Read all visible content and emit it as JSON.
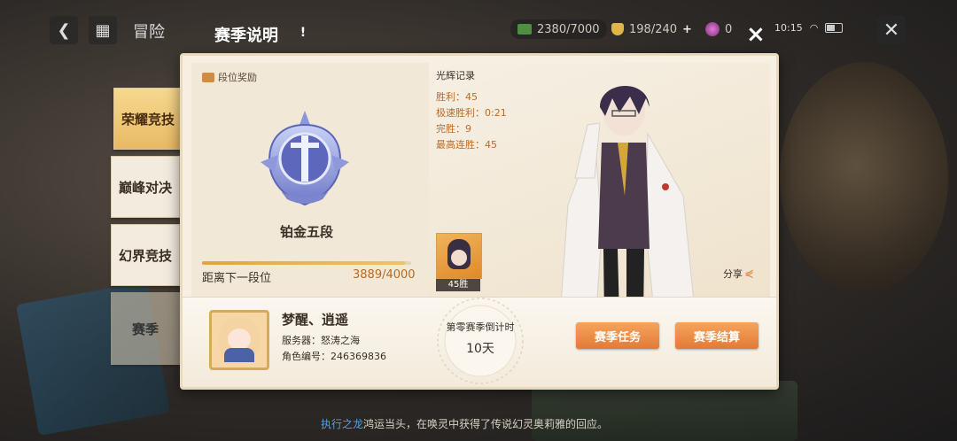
{
  "topbar": {
    "back_icon": "back-arrow-icon",
    "grid_icon": "grid-menu-icon",
    "adventure_label": "冒险",
    "page_title": "赛季说明",
    "info_icon_text": "!",
    "money": "2380/7000",
    "stamina": "198/240",
    "stamina_plus": "+",
    "crystal": "0",
    "time": "10:15",
    "close_x": "×",
    "close_outer": "✕"
  },
  "tabs": [
    {
      "label": "荣耀竞技",
      "active": true
    },
    {
      "label": "巅峰对决",
      "active": false
    },
    {
      "label": "幻界竞技",
      "active": false
    },
    {
      "label": "赛季",
      "active": false
    }
  ],
  "rank": {
    "section_label": "段位奖励",
    "rank_name": "铂金五段",
    "next_label": "距离下一段位",
    "next_value": "3889/4000",
    "progress_fraction": 0.97225
  },
  "glory": {
    "title": "光辉记录",
    "stats": [
      {
        "text": "胜利：45"
      },
      {
        "text": "极速胜利：0:21"
      },
      {
        "text": "完胜：9"
      },
      {
        "text": "最高连胜：45"
      }
    ],
    "wins_badge": "45胜",
    "share_label": "分享",
    "share_icon": "share-icon"
  },
  "player": {
    "name": "梦醒、逍遥",
    "server": "服务器：怒涛之海",
    "role_id": "角色编号：246369836"
  },
  "countdown": {
    "label": "第零赛季倒计时",
    "value": "10天"
  },
  "buttons": {
    "task": "赛季任务",
    "settle": "赛季结算"
  },
  "marquee": {
    "highlight": "执行之龙",
    "text": "鸿运当头，在唤灵中获得了传说幻灵奥莉雅的回应。"
  },
  "colors": {
    "accent_orange": "#e27a37",
    "stat_text": "#c06a24",
    "tab_active": "#e9b964",
    "marquee_highlight": "#5c9fe0"
  }
}
